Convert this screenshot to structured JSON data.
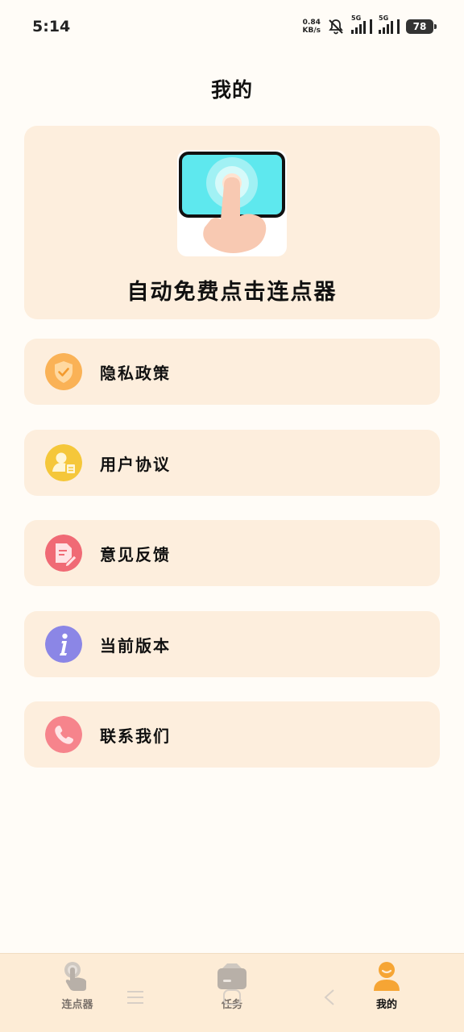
{
  "status_bar": {
    "time": "5:14",
    "net_speed_value": "0.84",
    "net_speed_unit": "KB/s",
    "sim1": "5G",
    "sim2": "5G",
    "battery": "78"
  },
  "page_title": "我的",
  "hero": {
    "title": "自动免费点击连点器",
    "icon": "tap-screen-icon"
  },
  "menu": [
    {
      "label": "隐私政策",
      "icon": "shield-check-icon",
      "color": "#f7a23b"
    },
    {
      "label": "用户协议",
      "icon": "user-document-icon",
      "color": "#f5c73a"
    },
    {
      "label": "意见反馈",
      "icon": "feedback-edit-icon",
      "color": "#f06a75"
    },
    {
      "label": "当前版本",
      "icon": "info-icon",
      "color": "#8b86e6"
    },
    {
      "label": "联系我们",
      "icon": "phone-icon",
      "color": "#f6848c"
    }
  ],
  "bottom_nav": {
    "tabs": [
      {
        "label": "连点器",
        "icon": "tap-finger-icon",
        "active": false
      },
      {
        "label": "任务",
        "icon": "task-folder-icon",
        "active": false
      },
      {
        "label": "我的",
        "icon": "profile-icon",
        "active": true
      }
    ],
    "active_color": "#f6a534",
    "inactive_color": "#b8b0a8"
  }
}
